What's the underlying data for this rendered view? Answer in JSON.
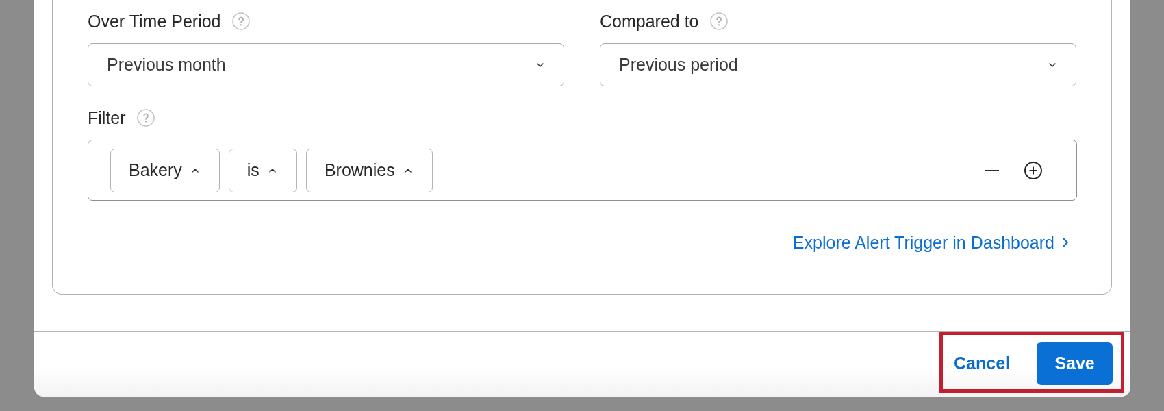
{
  "fields": [
    {
      "label": "Over Time Period",
      "value": "Previous month"
    },
    {
      "label": "Compared to",
      "value": "Previous period"
    }
  ],
  "filter": {
    "label": "Filter",
    "conditions": [
      "Bakery",
      "is",
      "Brownies"
    ]
  },
  "link": {
    "text": "Explore Alert Trigger in Dashboard"
  },
  "footer": {
    "highlighted": true,
    "buttons": [
      {
        "kind": "text",
        "label": "Cancel"
      },
      {
        "kind": "primary",
        "label": "Save"
      }
    ]
  }
}
